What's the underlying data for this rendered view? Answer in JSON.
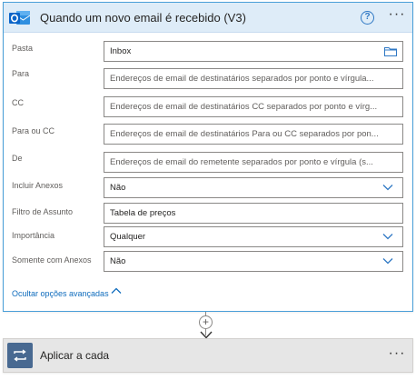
{
  "trigger": {
    "title": "Quando um novo email é recebido (V3)",
    "help_glyph": "?",
    "more_glyph": "···",
    "icon": "outlook-icon",
    "fields": [
      {
        "label": "Pasta",
        "value": "Inbox",
        "placeholder": "",
        "control": "folder-picker",
        "icon": "folder-icon"
      },
      {
        "label": "Para",
        "value": "",
        "placeholder": "Endereços de email de destinatários separados por ponto e vírgula...",
        "control": "text"
      },
      {
        "label": "CC",
        "value": "",
        "placeholder": "Endereços de email de destinatários CC separados por ponto e vírg...",
        "control": "text"
      },
      {
        "label": "Para ou CC",
        "value": "",
        "placeholder": "Endereços de email de destinatários Para ou CC separados por pon...",
        "control": "text"
      },
      {
        "label": "De",
        "value": "",
        "placeholder": "Endereços de email do remetente separados por ponto e vírgula (s...",
        "control": "text"
      },
      {
        "label": "Incluir Anexos",
        "value": "Não",
        "placeholder": "",
        "control": "dropdown",
        "icon": "chevron-down-icon"
      },
      {
        "label": "Filtro de Assunto",
        "value": "Tabela de preços",
        "placeholder": "",
        "control": "text"
      },
      {
        "label": "Importância",
        "value": "Qualquer",
        "placeholder": "",
        "control": "dropdown",
        "icon": "chevron-down-icon"
      },
      {
        "label": "Somente com Anexos",
        "value": "Não",
        "placeholder": "",
        "control": "dropdown",
        "icon": "chevron-down-icon"
      }
    ],
    "advanced_link": "Ocultar opções avançadas"
  },
  "connector": {
    "plus_glyph": "+"
  },
  "next_step": {
    "title": "Aplicar a cada",
    "more_glyph": "···",
    "icon": "loop-icon"
  },
  "colors": {
    "header_bg": "#deecf8",
    "card_border": "#4a9fd8",
    "link": "#0f6cbd",
    "outlook_blue": "#0a64c8",
    "loop_bg": "#486991",
    "step_bg": "#e6e6e6"
  }
}
